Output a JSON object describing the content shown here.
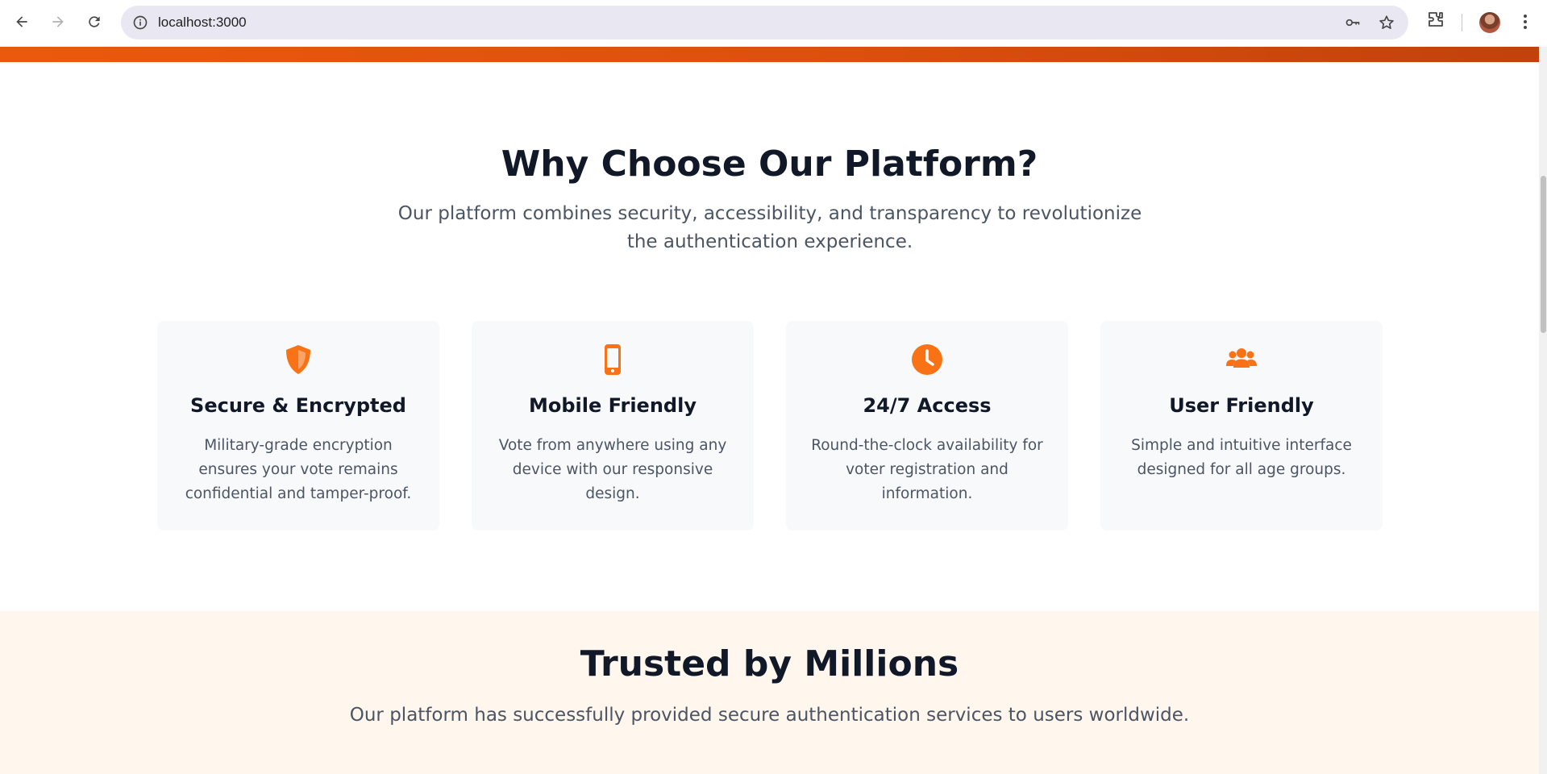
{
  "browser": {
    "url": "localhost:3000"
  },
  "why": {
    "title": "Why Choose Our Platform?",
    "subtitle": "Our platform combines security, accessibility, and transparency to revolutionize the authentication experience."
  },
  "features": [
    {
      "icon": "shield-icon",
      "title": "Secure & Encrypted",
      "text": "Military-grade encryption ensures your vote remains confidential and tamper-proof."
    },
    {
      "icon": "mobile-icon",
      "title": "Mobile Friendly",
      "text": "Vote from anywhere using any device with our responsive design."
    },
    {
      "icon": "clock-icon",
      "title": "24/7 Access",
      "text": "Round-the-clock availability for voter registration and information."
    },
    {
      "icon": "users-icon",
      "title": "User Friendly",
      "text": "Simple and intuitive interface designed for all age groups."
    }
  ],
  "trusted": {
    "title": "Trusted by Millions",
    "subtitle": "Our platform has successfully provided secure authentication services to users worldwide."
  },
  "colors": {
    "accent": "#f97316",
    "heading": "#111827",
    "body_text": "#4b5563",
    "card_bg": "#f8f9fb",
    "trusted_bg": "#fff6ee"
  }
}
